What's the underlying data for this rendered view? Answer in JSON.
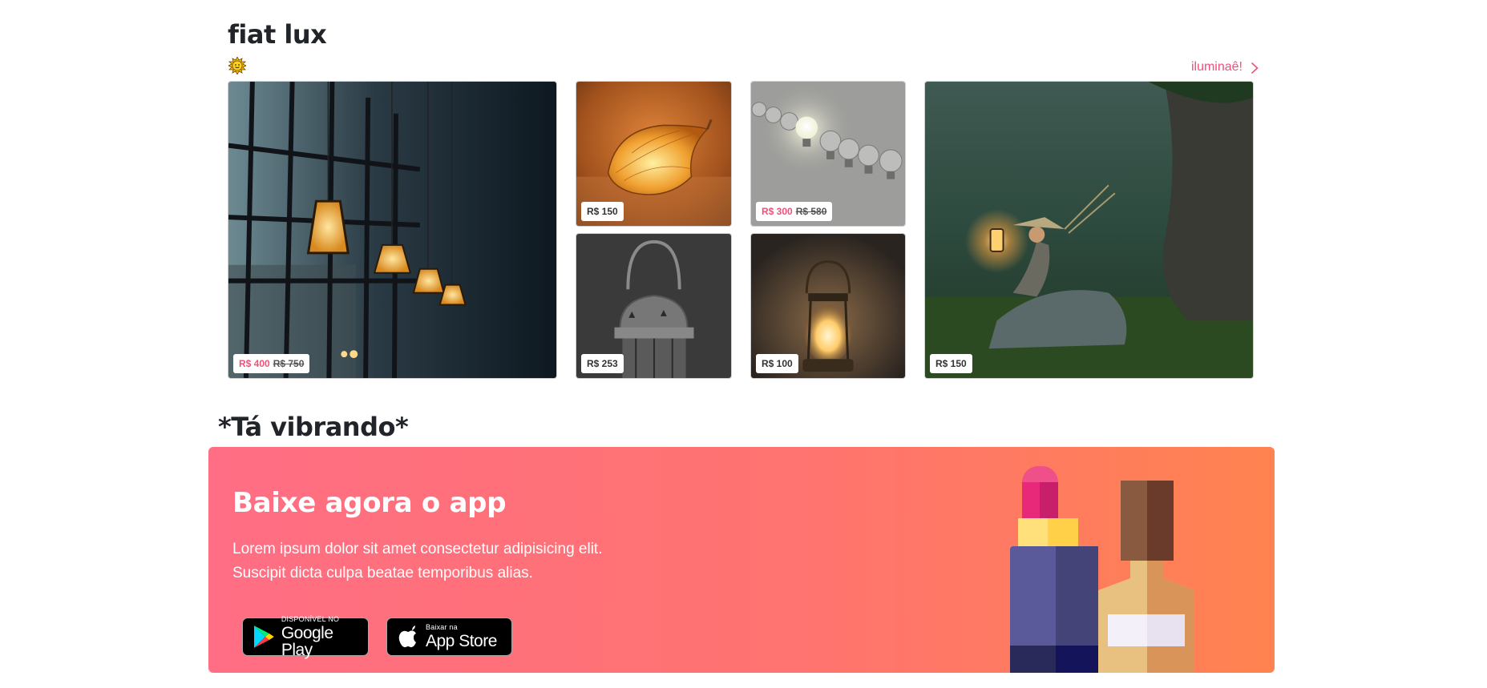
{
  "section": {
    "title": "fiat lux",
    "link_label": "iluminaê!",
    "icons": [
      "sun-icon",
      "chevron-right-icon"
    ],
    "accent_color": "#f0507a"
  },
  "products": [
    {
      "name": "window-pendant-lamps",
      "price": "R$ 400",
      "old_price": "R$ 750",
      "on_sale": true
    },
    {
      "name": "glowing-leaf",
      "price": "R$ 150",
      "old_price": "",
      "on_sale": false
    },
    {
      "name": "lightbulbs-row",
      "price": "R$ 300",
      "old_price": "R$ 580",
      "on_sale": true
    },
    {
      "name": "metal-lantern",
      "price": "R$ 253",
      "old_price": "",
      "on_sale": false
    },
    {
      "name": "oil-lantern",
      "price": "R$ 100",
      "old_price": "",
      "on_sale": false
    },
    {
      "name": "boy-with-lantern",
      "price": "R$ 150",
      "old_price": "",
      "on_sale": false
    }
  ],
  "vibe": {
    "title": "*Tá vibrando*"
  },
  "banner": {
    "title": "Baixe agora o app",
    "text_line1": "Lorem ipsum dolor sit amet consectetur adipisicing elit.",
    "text_line2": "Suscipit dicta culpa beatae temporibus alias.",
    "google_play": {
      "small": "DISPONÍVEL NO",
      "big": "Google Play"
    },
    "app_store": {
      "small": "Baixar na",
      "big": "App Store"
    },
    "gradient": [
      "#ff6e84",
      "#ff8350"
    ]
  }
}
